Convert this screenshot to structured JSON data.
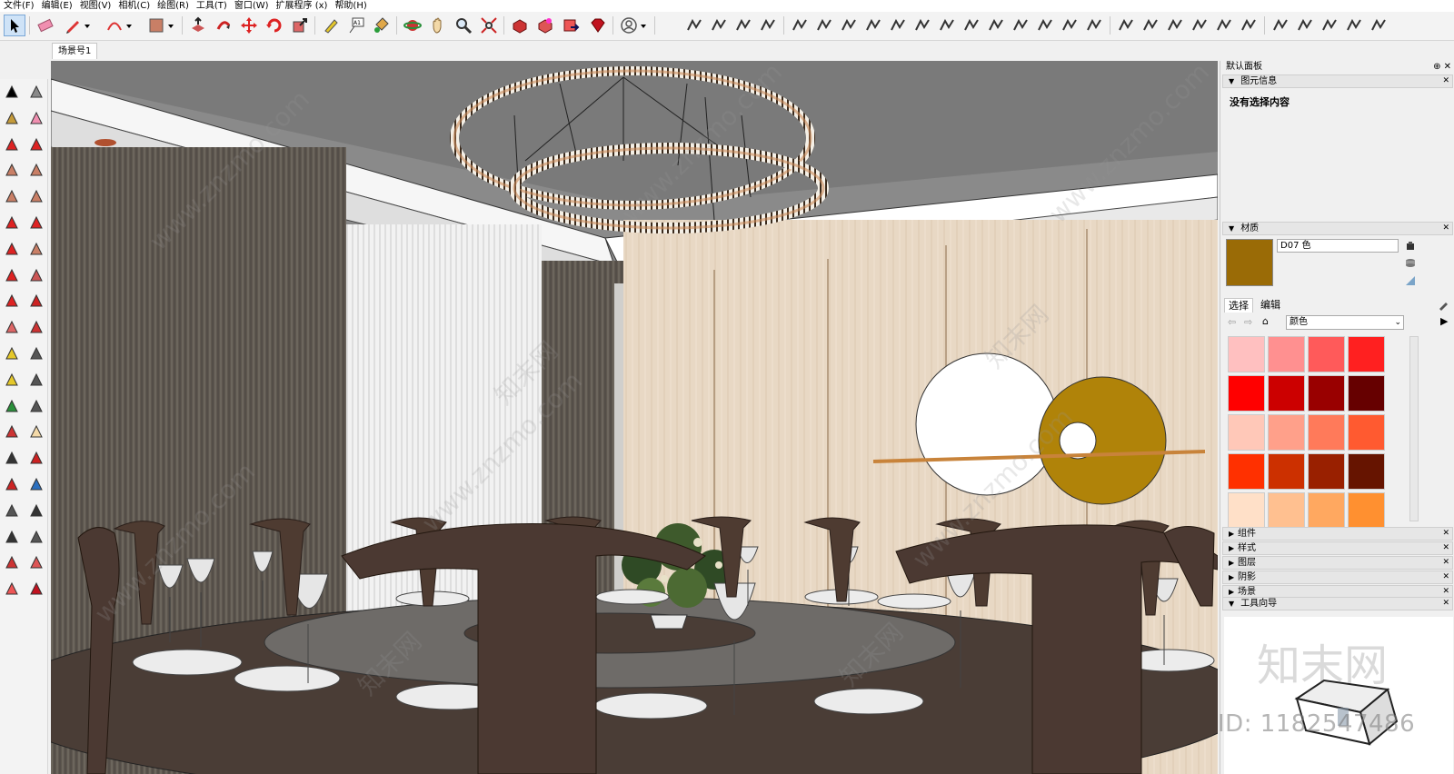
{
  "menu": [
    {
      "label": "文件(F)"
    },
    {
      "label": "编辑(E)"
    },
    {
      "label": "视图(V)"
    },
    {
      "label": "相机(C)"
    },
    {
      "label": "绘图(R)"
    },
    {
      "label": "工具(T)"
    },
    {
      "label": "窗口(W)"
    },
    {
      "label": "扩展程序 (x)"
    },
    {
      "label": "帮助(H)"
    }
  ],
  "scene_tab": "场景号1",
  "panel": {
    "tray_title": "默认面板",
    "entity_info": {
      "title": "图元信息",
      "empty_text": "没有选择内容"
    },
    "materials": {
      "title": "材质",
      "current_name": "D07 色",
      "current_color": "#9a6b06",
      "tab_select": "选择",
      "tab_edit": "编辑",
      "library": "颜色",
      "swatches": [
        "#ffc0c0",
        "#ff9090",
        "#ff5a5a",
        "#ff2020",
        "#ff0000",
        "#cc0000",
        "#990000",
        "#660000",
        "#ffc8b8",
        "#ffa08a",
        "#ff7a5a",
        "#ff5a30",
        "#ff3000",
        "#cc3000",
        "#992000",
        "#661400",
        "#ffe0c8",
        "#ffc090",
        "#ffa860",
        "#ff9030"
      ]
    },
    "collapsed_sections": [
      {
        "label": "组件"
      },
      {
        "label": "样式"
      },
      {
        "label": "图层"
      },
      {
        "label": "阴影"
      },
      {
        "label": "场景"
      }
    ],
    "instructor": {
      "title": "工具向导"
    }
  },
  "watermark": {
    "site_text": "www.znzmo.com",
    "brand": "知末网",
    "id_text": "ID: 1182547486"
  }
}
